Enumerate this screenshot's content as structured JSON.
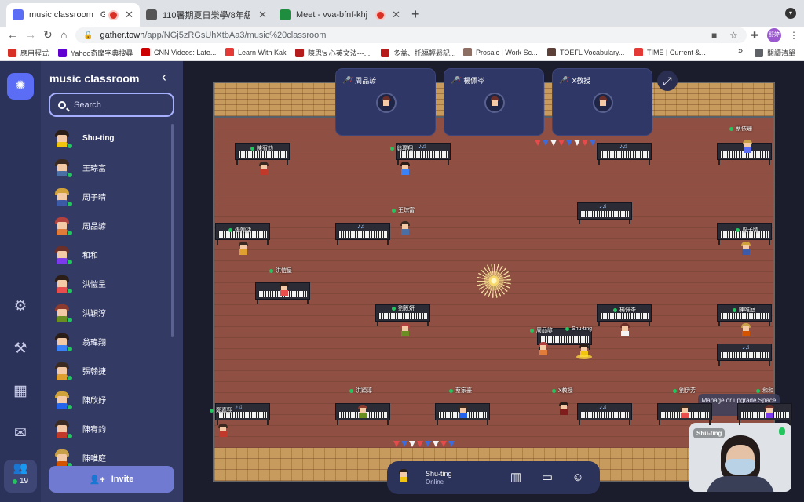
{
  "browser": {
    "tabs": [
      {
        "title": "music classroom | Gather",
        "recording": true,
        "active": true,
        "favicon_color": "#5b6df5"
      },
      {
        "title": "110暑期夏日樂學/8年級",
        "recording": false,
        "active": false,
        "favicon_color": "#555555"
      },
      {
        "title": "Meet - vva-bfnf-khj",
        "recording": true,
        "active": false,
        "favicon_color": "#1e8e3e"
      }
    ],
    "url_host": "gather.town",
    "url_path": "/app/NGj5zRGsUhXtbAa3/music%20classroom",
    "profile_label": "舒婷",
    "bookmarks": [
      {
        "label": "應用程式",
        "color": "#d93025"
      },
      {
        "label": "Yahoo奇摩字典搜尋",
        "color": "#6001d2"
      },
      {
        "label": "CNN Videos: Late...",
        "color": "#cc0000"
      },
      {
        "label": "Learn With Kak",
        "color": "#e53935"
      },
      {
        "label": "陳思's 心英文法---...",
        "color": "#b71c1c"
      },
      {
        "label": "多益、托福輕鬆記...",
        "color": "#b71c1c"
      },
      {
        "label": "Prosaic | Work Sc...",
        "color": "#8d6e63"
      },
      {
        "label": "TOEFL Vocabulary...",
        "color": "#5d4037"
      },
      {
        "label": "TIME | Current &...",
        "color": "#e53935"
      }
    ],
    "reading_list": "閱讀清單",
    "more": "»"
  },
  "sidebar": {
    "title": "music classroom",
    "search_placeholder": "Search",
    "participants": [
      {
        "name": "Shu-ting",
        "self": true,
        "hair": "#2b1d17",
        "shirt": "#f1c40f"
      },
      {
        "name": "王琮富",
        "self": false,
        "hair": "#3a2a22",
        "shirt": "#4a6fa5"
      },
      {
        "name": "周子晴",
        "self": false,
        "hair": "#d1a23a",
        "shirt": "#3c5aa6"
      },
      {
        "name": "周品諺",
        "self": false,
        "hair": "#b0413e",
        "shirt": "#e07b39"
      },
      {
        "name": "和和",
        "self": false,
        "hair": "#6b2f2a",
        "shirt": "#7c3aed"
      },
      {
        "name": "洪愷呈",
        "self": false,
        "hair": "#2b1d17",
        "shirt": "#e84e4e"
      },
      {
        "name": "洪穎淳",
        "self": false,
        "hair": "#8b3a2f",
        "shirt": "#6b8e23"
      },
      {
        "name": "翁瑋翔",
        "self": false,
        "hair": "#2b1d17",
        "shirt": "#3b82f6"
      },
      {
        "name": "張翰捷",
        "self": false,
        "hair": "#3a2a22",
        "shirt": "#e0a030"
      },
      {
        "name": "陳欣妤",
        "self": false,
        "hair": "#d1a23a",
        "shirt": "#2563eb"
      },
      {
        "name": "陳宥鈞",
        "self": false,
        "hair": "#3a2a22",
        "shirt": "#c0392b"
      },
      {
        "name": "陳唯庭",
        "self": false,
        "hair": "#c8a04a",
        "shirt": "#d35400"
      }
    ],
    "invite_label": "Invite"
  },
  "rail": {
    "people_count": "19"
  },
  "map": {
    "video_tiles": [
      {
        "name": "周品諺",
        "muted": true
      },
      {
        "name": "楊佩岑",
        "muted": true
      },
      {
        "name": "X教授",
        "muted": true
      }
    ],
    "name_labels": [
      {
        "text": "陳宥鈞"
      },
      {
        "text": "翁瑋翔"
      },
      {
        "text": "蔡依珊"
      },
      {
        "text": "王琮富"
      },
      {
        "text": "張翰捷"
      },
      {
        "text": "周子晴"
      },
      {
        "text": "洪愷呈"
      },
      {
        "text": "劉筱妍"
      },
      {
        "text": "楊佩岑"
      },
      {
        "text": "陳唯庭"
      },
      {
        "text": "周品諺"
      },
      {
        "text": "Shu-ting"
      },
      {
        "text": "洪穎淳"
      },
      {
        "text": "蔡家豪"
      },
      {
        "text": "X教授"
      },
      {
        "text": "劉伊芳"
      },
      {
        "text": "和和"
      },
      {
        "text": "鄭嘉翔"
      }
    ],
    "manage_text": "Manage or upgrade Space",
    "self_cam_label": "Shu-ting"
  },
  "bottombar": {
    "name": "Shu-ting",
    "status": "Online"
  }
}
